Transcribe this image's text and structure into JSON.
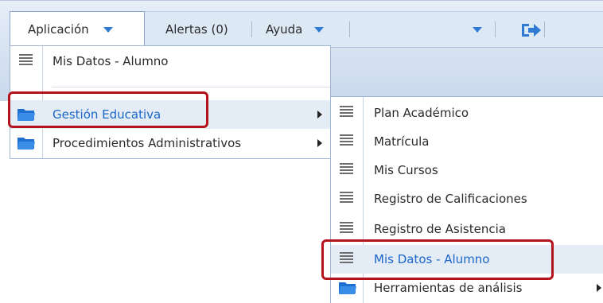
{
  "menubar": {
    "aplicacion": "Aplicación",
    "alertas": "Alertas (0)",
    "ayuda": "Ayuda"
  },
  "app_menu": {
    "items": [
      {
        "label": "Mis Datos - Alumno",
        "icon": "list-icon"
      },
      {
        "label": "Gestión Educativa",
        "icon": "folder-icon"
      },
      {
        "label": "Procedimientos Administrativos",
        "icon": "folder-icon"
      }
    ]
  },
  "submenu": {
    "items": [
      {
        "label": "Plan Académico",
        "icon": "list-icon"
      },
      {
        "label": "Matrícula",
        "icon": "list-icon"
      },
      {
        "label": "Mis Cursos",
        "icon": "list-icon"
      },
      {
        "label": "Registro de Calificaciones",
        "icon": "list-icon"
      },
      {
        "label": "Registro de Asistencia",
        "icon": "list-icon"
      },
      {
        "label": "Mis Datos - Alumno",
        "icon": "list-icon"
      },
      {
        "label": "Herramientas de análisis",
        "icon": "folder-icon"
      }
    ]
  },
  "colors": {
    "accent": "#2f7bd4",
    "highlight_box": "#b4121d",
    "active_text": "#1b66c9"
  }
}
